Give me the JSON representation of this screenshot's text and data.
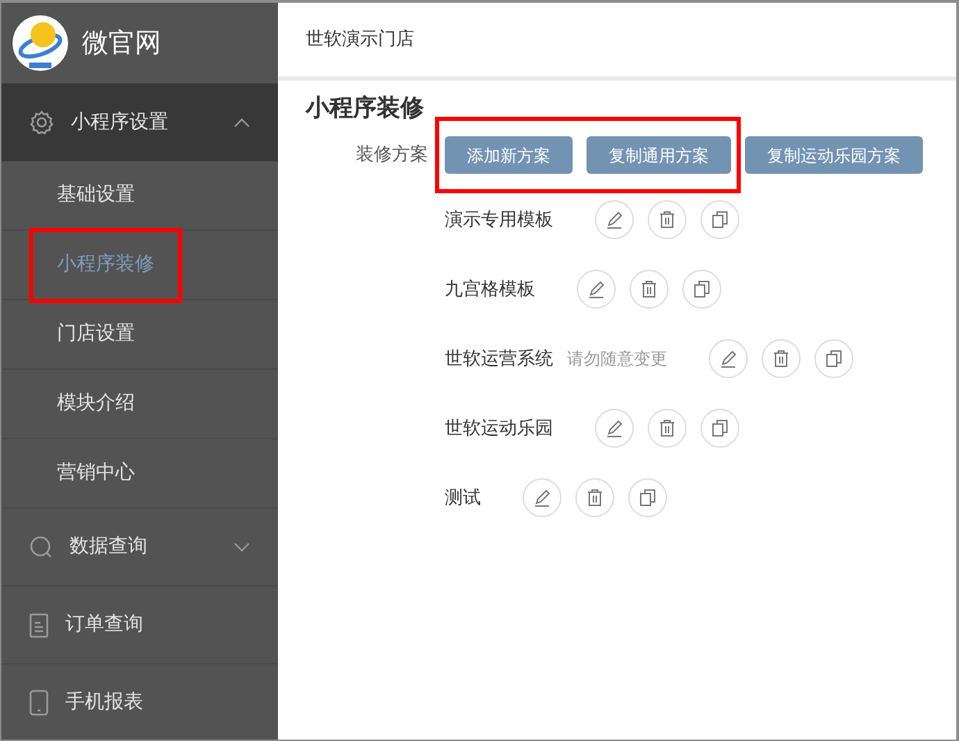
{
  "brand": {
    "name": "微官网"
  },
  "sidebar": {
    "items": [
      {
        "kind": "group",
        "label": "小程序设置",
        "expanded": true,
        "children": [
          {
            "label": "基础设置",
            "selected": false,
            "highlighted": false
          },
          {
            "label": "小程序装修",
            "selected": true,
            "highlighted": true
          },
          {
            "label": "门店设置",
            "selected": false,
            "highlighted": false
          },
          {
            "label": "模块介绍",
            "selected": false,
            "highlighted": false
          },
          {
            "label": "营销中心",
            "selected": false,
            "highlighted": false
          }
        ]
      },
      {
        "kind": "group",
        "label": "数据查询",
        "expanded": false
      },
      {
        "kind": "link",
        "label": "订单查询"
      },
      {
        "kind": "link",
        "label": "手机报表"
      }
    ]
  },
  "header": {
    "breadcrumb": "世软演示门店"
  },
  "page": {
    "title": "小程序装修",
    "scheme_label": "装修方案",
    "buttons": [
      {
        "label": "添加新方案",
        "highlighted": true
      },
      {
        "label": "复制通用方案",
        "highlighted": true
      },
      {
        "label": "复制运动乐园方案",
        "highlighted": false
      }
    ],
    "templates": [
      {
        "name": "演示专用模板"
      },
      {
        "name": "九宫格模板"
      },
      {
        "name": "世软运营系统",
        "note": "请勿随意变更"
      },
      {
        "name": "世软运动乐园"
      },
      {
        "name": "测试"
      }
    ]
  }
}
